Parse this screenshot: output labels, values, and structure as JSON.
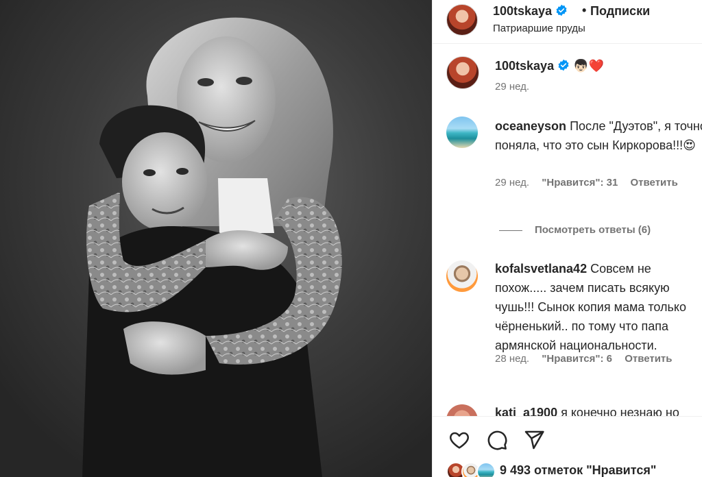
{
  "post": {
    "photo_alt": "black and white photo of a woman hugging a boy"
  },
  "header": {
    "username": "100tskaya",
    "separator": "•",
    "follow_state": "Подписки",
    "location": "Патриаршие пруды"
  },
  "caption": {
    "username": "100tskaya",
    "text": "👦🏻❤️",
    "time": "29 нед."
  },
  "comments": [
    {
      "username": "oceaneyson",
      "text": "После \"Дуэтов\", я точно поняла, что это сын Киркорова!!!😍",
      "time": "29 нед.",
      "likes": "\"Нравится\": 31",
      "reply": "Ответить",
      "view_replies": "Посмотреть ответы (6)"
    },
    {
      "username": "kofalsvetlana42",
      "text": "Совсем не похож..... зачем писать всякую чушь!!! Сынок копия мама только чёрненький.. по тому что папа армянской национальности.",
      "time": "28 нед.",
      "likes": "\"Нравится\": 6",
      "reply": "Ответить"
    },
    {
      "username": "kati_a1900",
      "text": "я конечно незнаю но"
    }
  ],
  "actions": {
    "like_icon": "heart-icon",
    "comment_icon": "comment-icon",
    "share_icon": "share-icon",
    "likes_count": "9 493 отметок \"Нравится\""
  },
  "colors": {
    "verified": "#0095f6",
    "muted_text": "#737373"
  }
}
